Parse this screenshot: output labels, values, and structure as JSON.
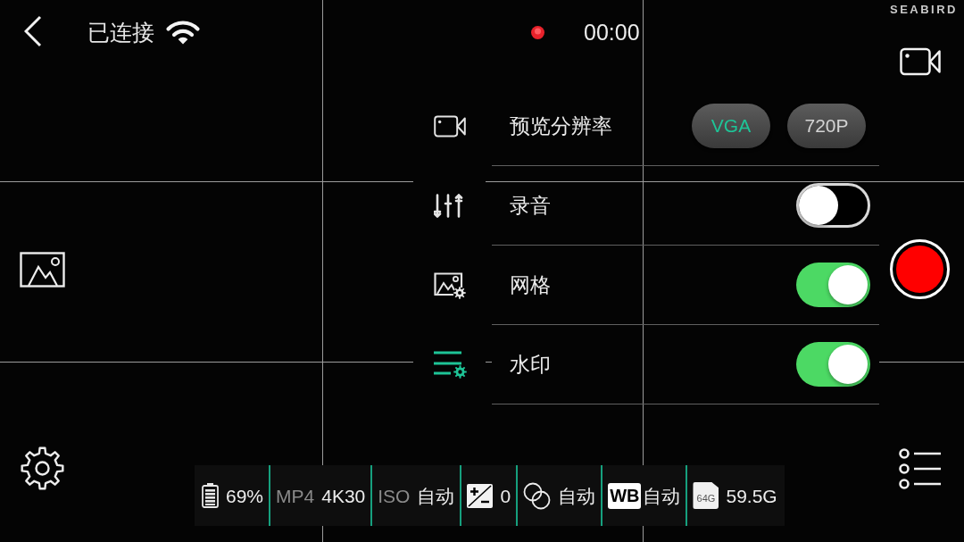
{
  "top_bar": {
    "connection_status": "已连接",
    "recording_time": "00:00",
    "logo": "SEABIRD"
  },
  "settings": {
    "tabs": [
      {
        "kind": "video",
        "selected": false
      },
      {
        "kind": "sliders",
        "selected": false
      },
      {
        "kind": "image",
        "selected": false
      },
      {
        "kind": "list",
        "selected": true
      }
    ],
    "rows": [
      {
        "kind": "choice",
        "label": "预览分辨率",
        "options": [
          {
            "label": "VGA",
            "selected": true
          },
          {
            "label": "720P",
            "selected": false
          }
        ]
      },
      {
        "kind": "toggle",
        "label": "录音",
        "on": false
      },
      {
        "kind": "toggle",
        "label": "网格",
        "on": true
      },
      {
        "kind": "toggle",
        "label": "水印",
        "on": true
      }
    ]
  },
  "status_bar": [
    {
      "kind": "battery",
      "value": "69%"
    },
    {
      "kind": "format",
      "label": "MP4",
      "value": "4K30"
    },
    {
      "kind": "iso",
      "label": "ISO",
      "value": "自动"
    },
    {
      "kind": "exposure",
      "value": "0"
    },
    {
      "kind": "filter",
      "value": "自动"
    },
    {
      "kind": "white_balance",
      "badge": "WB",
      "value": "自动"
    },
    {
      "kind": "storage",
      "badge": "64G",
      "value": "59.5G"
    }
  ]
}
